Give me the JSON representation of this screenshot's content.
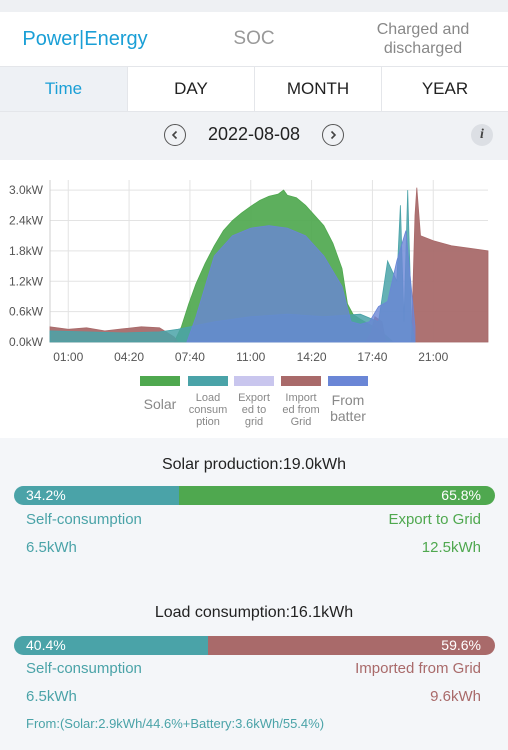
{
  "tabs": [
    {
      "label": "Power|Energy"
    },
    {
      "label": "SOC"
    },
    {
      "label_line1": "Charged and",
      "label_line2": "discharged"
    }
  ],
  "period": {
    "items": [
      "Time",
      "DAY",
      "MONTH",
      "YEAR"
    ],
    "active": "Time"
  },
  "date": {
    "value": "2022-08-08",
    "prev_icon": "chevron-left-icon",
    "next_icon": "chevron-right-icon",
    "info_label": "i"
  },
  "chart_data": {
    "type": "area",
    "xlabel": "",
    "ylabel": "",
    "y_ticks": [
      "0.0kW",
      "0.6kW",
      "1.2kW",
      "1.8kW",
      "2.4kW",
      "3.0kW"
    ],
    "x_ticks": [
      "01:00",
      "04:20",
      "07:40",
      "11:00",
      "14:20",
      "17:40",
      "21:00"
    ],
    "ylim": [
      0,
      3.2
    ],
    "xlim_hours": [
      0,
      24
    ],
    "grid": true,
    "series": [
      {
        "name": "Solar",
        "color": "#4fa84f",
        "points": [
          [
            6.8,
            0
          ],
          [
            7.2,
            0.3
          ],
          [
            7.6,
            0.75
          ],
          [
            8.0,
            1.15
          ],
          [
            8.5,
            1.55
          ],
          [
            9.0,
            1.9
          ],
          [
            9.5,
            2.2
          ],
          [
            10.0,
            2.4
          ],
          [
            10.5,
            2.55
          ],
          [
            11.0,
            2.68
          ],
          [
            11.5,
            2.8
          ],
          [
            12.0,
            2.88
          ],
          [
            12.5,
            2.92
          ],
          [
            12.8,
            3.0
          ],
          [
            13.0,
            2.9
          ],
          [
            13.5,
            2.85
          ],
          [
            14.0,
            2.7
          ],
          [
            14.5,
            2.5
          ],
          [
            15.0,
            2.3
          ],
          [
            15.5,
            1.95
          ],
          [
            16.0,
            1.45
          ],
          [
            16.3,
            0.75
          ],
          [
            16.6,
            0.55
          ],
          [
            17.0,
            0.45
          ],
          [
            17.5,
            0.35
          ],
          [
            18.0,
            0.25
          ],
          [
            18.5,
            0.1
          ],
          [
            18.8,
            0
          ]
        ]
      },
      {
        "name": "Load consumption",
        "color": "#4aa3a8",
        "points": [
          [
            0,
            0.22
          ],
          [
            2,
            0.2
          ],
          [
            4,
            0.18
          ],
          [
            6,
            0.2
          ],
          [
            7,
            0.25
          ],
          [
            9,
            0.4
          ],
          [
            11,
            0.5
          ],
          [
            13,
            0.55
          ],
          [
            15,
            0.5
          ],
          [
            17,
            0.55
          ],
          [
            18,
            0.4
          ],
          [
            18.5,
            1.6
          ],
          [
            19,
            1.2
          ],
          [
            19.2,
            2.7
          ],
          [
            19.4,
            0.4
          ],
          [
            19.6,
            3.0
          ],
          [
            19.8,
            0.4
          ],
          [
            20,
            0
          ]
        ]
      },
      {
        "name": "Export to grid",
        "color": "#c9c6ee",
        "points": []
      },
      {
        "name": "Import from Grid",
        "color": "#a96a6a",
        "points": [
          [
            0,
            0.3
          ],
          [
            1,
            0.25
          ],
          [
            2,
            0.28
          ],
          [
            3,
            0.22
          ],
          [
            4,
            0.26
          ],
          [
            5,
            0.3
          ],
          [
            6,
            0.28
          ],
          [
            6.8,
            0.1
          ],
          [
            7,
            0
          ],
          [
            17.3,
            0
          ],
          [
            17.6,
            0.2
          ],
          [
            17.8,
            0.5
          ],
          [
            18.2,
            0.4
          ],
          [
            18.4,
            0
          ],
          [
            19.8,
            0
          ],
          [
            20.0,
            2.5
          ],
          [
            20.1,
            3.05
          ],
          [
            20.3,
            2.1
          ],
          [
            21,
            2.0
          ],
          [
            22,
            1.9
          ],
          [
            23,
            1.85
          ],
          [
            24,
            1.8
          ]
        ]
      },
      {
        "name": "From battery",
        "color": "#6a86d6",
        "points": [
          [
            7.5,
            0
          ],
          [
            8,
            0.5
          ],
          [
            9,
            1.7
          ],
          [
            10,
            2.1
          ],
          [
            11,
            2.25
          ],
          [
            12,
            2.3
          ],
          [
            13,
            2.25
          ],
          [
            14,
            2.1
          ],
          [
            15,
            1.7
          ],
          [
            16,
            1.1
          ],
          [
            16.5,
            0.4
          ],
          [
            17,
            0.35
          ],
          [
            17.5,
            0.4
          ],
          [
            18,
            0.7
          ],
          [
            18.5,
            0.8
          ],
          [
            19,
            1.6
          ],
          [
            19.5,
            2.2
          ],
          [
            20,
            0.3
          ]
        ]
      }
    ]
  },
  "legend": [
    {
      "line1": "Solar",
      "line2": "",
      "line3": ""
    },
    {
      "line1": "Load",
      "line2": "consum",
      "line3": "ption"
    },
    {
      "line1": "Export",
      "line2": "ed to",
      "line3": "grid"
    },
    {
      "line1": "Import",
      "line2": "ed from",
      "line3": "Grid"
    },
    {
      "line1": "From",
      "line2": "batter",
      "line3": ""
    }
  ],
  "colors": {
    "accent": "#1a9fd6",
    "self": "#4aa3a8",
    "export": "#4fa84f",
    "import": "#a96a6a"
  },
  "solar": {
    "title": "Solar production:19.0kWh",
    "self_pct": "34.2%",
    "self_frac": 0.342,
    "export_pct": "65.8%",
    "self_label": "Self-consumption",
    "export_label": "Export to Grid",
    "self_value": "6.5kWh",
    "export_value": "12.5kWh"
  },
  "load": {
    "title": "Load consumption:16.1kWh",
    "self_pct": "40.4%",
    "self_frac": 0.404,
    "import_pct": "59.6%",
    "self_label": "Self-consumption",
    "import_label": "Imported from Grid",
    "self_value": "6.5kWh",
    "import_value": "9.6kWh",
    "from_text": "From:(Solar:2.9kWh/44.6%+Battery:3.6kWh/55.4%)"
  }
}
